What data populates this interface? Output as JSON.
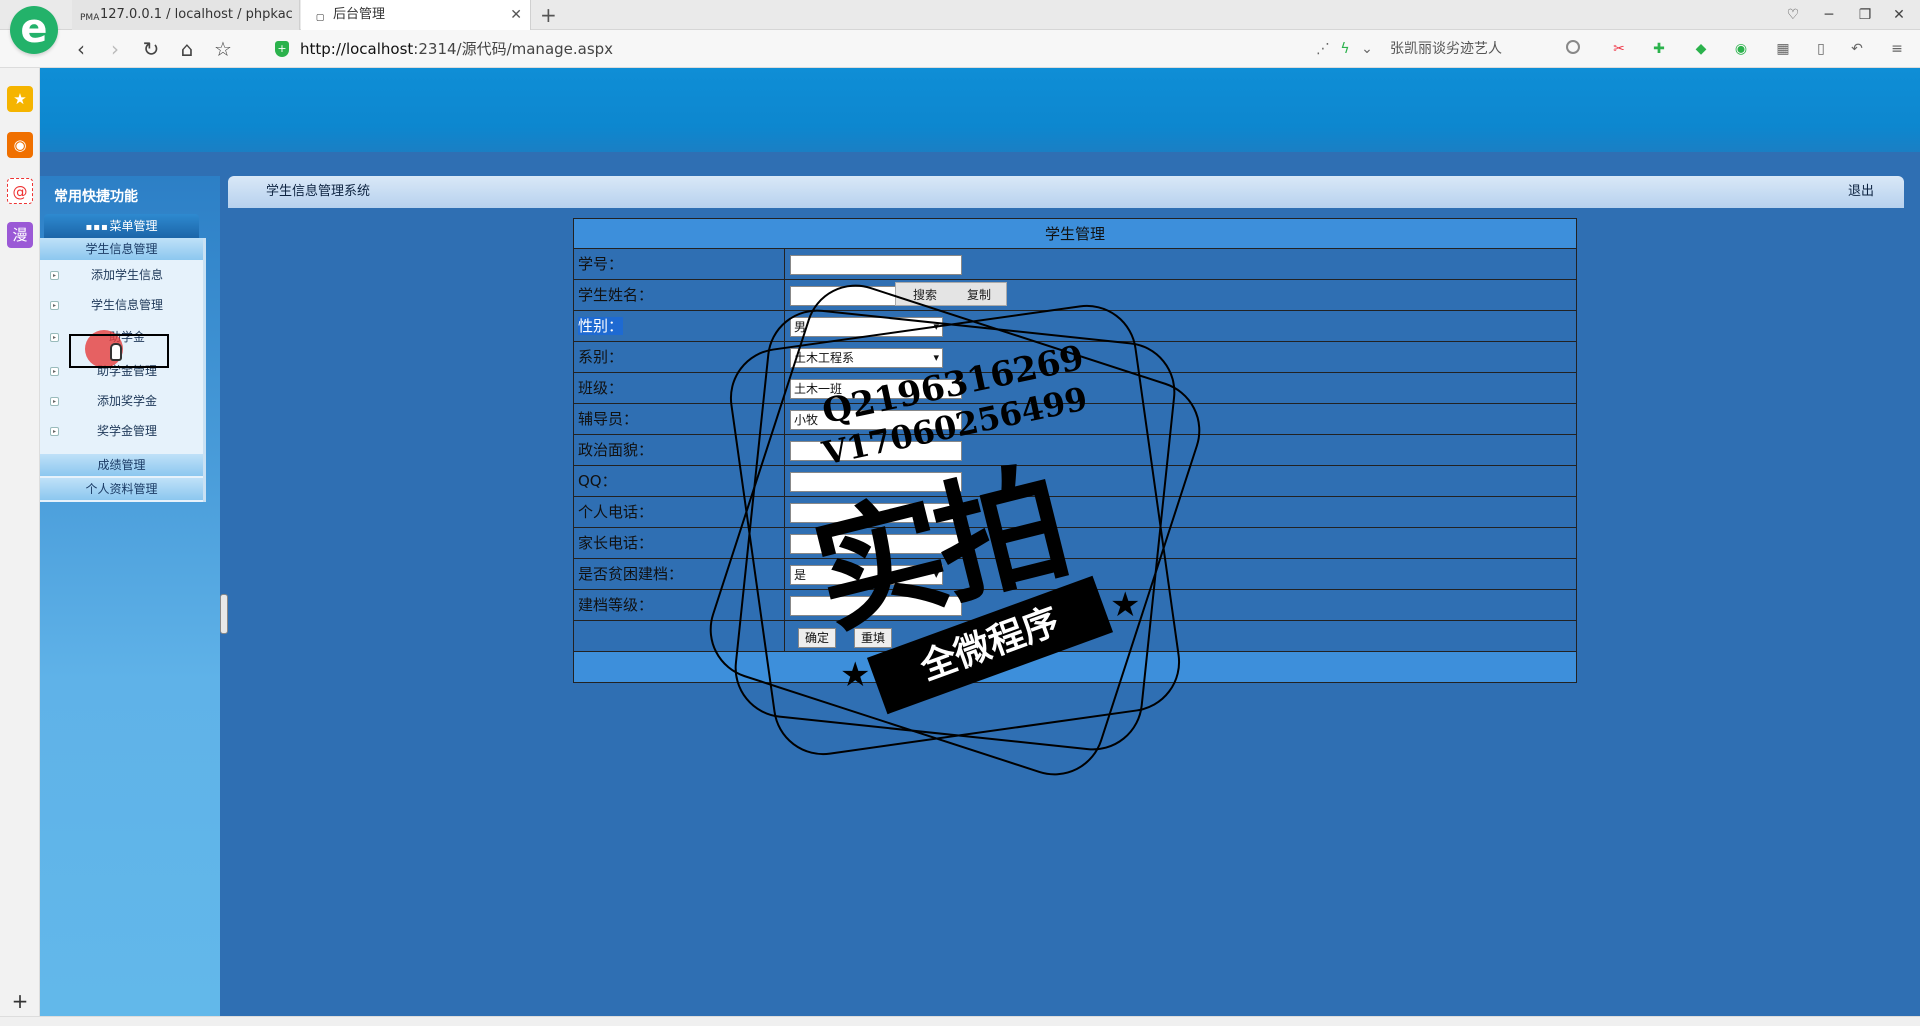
{
  "browser": {
    "tabs": [
      {
        "label": "127.0.0.1 / localhost / phpkac",
        "favicon": "PMA"
      },
      {
        "label": "后台管理"
      }
    ],
    "new_tab": "+",
    "url": "http://localhost:2314/源代码/manage.aspx",
    "url_host": "http://localhost",
    "url_rest": ":2314/源代码/manage.aspx",
    "search_text": "张凯丽谈劣迹艺人",
    "logo_glyph": "e",
    "sidestrip_icons": [
      "star-icon",
      "weibo-icon",
      "email-icon",
      "comic-icon"
    ],
    "sidestrip_labels": [
      "★",
      "◉",
      "@",
      "漫"
    ]
  },
  "app": {
    "left_title": "常用快捷功能",
    "menu_head": "菜单管理",
    "menu_head_icon": "▪▪▪",
    "sections": [
      {
        "label": "学生信息管理"
      },
      {
        "label": "成绩管理"
      },
      {
        "label": "个人资料管理"
      }
    ],
    "menu_items": [
      {
        "label": "添加学生信息"
      },
      {
        "label": "学生信息管理"
      },
      {
        "label": "助学金"
      },
      {
        "label": "助学金管理"
      },
      {
        "label": "添加奖学金"
      },
      {
        "label": "奖学金管理"
      }
    ],
    "bullet": "▸",
    "system_title": "学生信息管理系统",
    "logout": "退出"
  },
  "form": {
    "caption": "学生管理",
    "rows": [
      {
        "label": "学号：",
        "kind": "input",
        "value": ""
      },
      {
        "label": "学生姓名：",
        "kind": "input",
        "value": ""
      },
      {
        "label": "性别：",
        "kind": "select",
        "value": "男",
        "selected_label": true
      },
      {
        "label": "系别：",
        "kind": "select",
        "value": "土木工程系"
      },
      {
        "label": "班级：",
        "kind": "input",
        "value": "土木一班"
      },
      {
        "label": "辅导员：",
        "kind": "input",
        "value": "小牧"
      },
      {
        "label": "政治面貌：",
        "kind": "input",
        "value": ""
      },
      {
        "label": "QQ：",
        "kind": "input",
        "value": ""
      },
      {
        "label": "个人电话：",
        "kind": "input",
        "value": ""
      },
      {
        "label": "家长电话：",
        "kind": "input",
        "value": ""
      },
      {
        "label": "是否贫困建档：",
        "kind": "select",
        "value": "是"
      },
      {
        "label": "建档等级：",
        "kind": "input",
        "value": ""
      }
    ],
    "confirm_label": "确定",
    "reset_label": "重填"
  },
  "popup": {
    "search_label": "搜索",
    "copy_label": "复制"
  },
  "watermark": {
    "qq": "Q2196316269",
    "v": "V17060256499",
    "big": "实拍",
    "ribbon": "全微程序"
  },
  "colors": {
    "header": "#0f8ed6",
    "main_bg": "#2f6fb3",
    "caption": "#3d8fdb",
    "accent_green": "#23b26a"
  }
}
